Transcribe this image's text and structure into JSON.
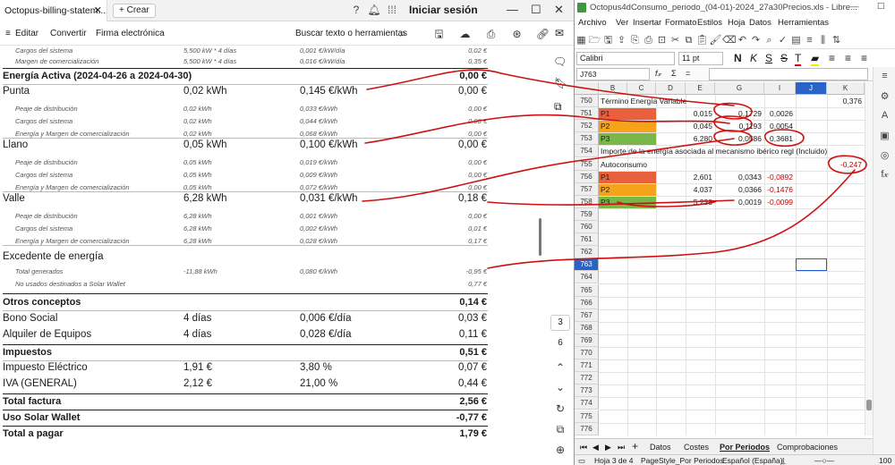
{
  "pdf": {
    "tab_title": "Octopus-billing-statem...",
    "new_tab": "Crear",
    "signin": "Iniciar sesión",
    "menu": {
      "edit": "Editar",
      "convert": "Convertir",
      "sign": "Firma electrónica",
      "search": "Buscar texto o herramientas"
    },
    "top_rows": [
      {
        "label": "Cargos del sistema",
        "c1": "5,500 kW * 4 días",
        "c2": "0,001 €/kW/día",
        "c3": "0,02 €"
      },
      {
        "label": "Margen de comercialización",
        "c1": "5,500 kW * 4 días",
        "c2": "0,016 €/kW/día",
        "c3": "0,35 €"
      }
    ],
    "energy_header": {
      "title": "Energía Activa (2024-04-26 a 2024-04-30)",
      "total": "0,00 €"
    },
    "periods": [
      {
        "name": "Punta",
        "qty": "0,02 kWh",
        "price": "0,145 €/kWh",
        "amount": "0,00 €",
        "subs": [
          {
            "label": "Peaje de distribución",
            "qty": "0,02 kWh",
            "price": "0,033 €/kWh",
            "amount": "0,00 €"
          },
          {
            "label": "Cargos del sistema",
            "qty": "0,02 kWh",
            "price": "0,044 €/kWh",
            "amount": "0,00 €"
          },
          {
            "label": "Energía y Margen de comercialización",
            "qty": "0,02 kWh",
            "price": "0,068 €/kWh",
            "amount": "0,00 €"
          }
        ]
      },
      {
        "name": "Llano",
        "qty": "0,05 kWh",
        "price": "0,100 €/kWh",
        "amount": "0,00 €",
        "subs": [
          {
            "label": "Peaje de distribución",
            "qty": "0,05 kWh",
            "price": "0,019 €/kWh",
            "amount": "0,00 €"
          },
          {
            "label": "Cargos del sistema",
            "qty": "0,05 kWh",
            "price": "0,009 €/kWh",
            "amount": "0,00 €"
          },
          {
            "label": "Energía y Margen de comercialización",
            "qty": "0,05 kWh",
            "price": "0,072 €/kWh",
            "amount": "0,00 €"
          }
        ]
      },
      {
        "name": "Valle",
        "qty": "6,28 kWh",
        "price": "0,031 €/kWh",
        "amount": "0,18 €",
        "subs": [
          {
            "label": "Peaje de distribución",
            "qty": "6,28 kWh",
            "price": "0,001 €/kWh",
            "amount": "0,00 €"
          },
          {
            "label": "Cargos del sistema",
            "qty": "6,28 kWh",
            "price": "0,002 €/kWh",
            "amount": "0,01 €"
          },
          {
            "label": "Energía y Margen de comercialización",
            "qty": "6,28 kWh",
            "price": "0,028 €/kWh",
            "amount": "0,17 €"
          }
        ]
      }
    ],
    "excedente": {
      "title": "Excedente de energía",
      "subs": [
        {
          "label": "Total generados",
          "qty": "-11,88 kWh",
          "price": "0,080 €/kWh",
          "amount": "-0,95 €"
        },
        {
          "label": "No usados destinados a Solar Wallet",
          "qty": "",
          "price": "",
          "amount": "0,77 €"
        }
      ]
    },
    "otros": {
      "title": "Otros conceptos",
      "total": "0,14 €",
      "rows": [
        {
          "label": "Bono Social",
          "qty": "4 días",
          "price": "0,006 €/día",
          "amount": "0,03 €"
        },
        {
          "label": "Alquiler de Equipos",
          "qty": "4 días",
          "price": "0,028 €/día",
          "amount": "0,11 €"
        }
      ]
    },
    "impuestos": {
      "title": "Impuestos",
      "total": "0,51 €",
      "rows": [
        {
          "label": "Impuesto Eléctrico",
          "qty": "1,91 €",
          "price": "3,80 %",
          "amount": "0,07 €"
        },
        {
          "label": "IVA (GENERAL)",
          "qty": "2,12 €",
          "price": "21,00 %",
          "amount": "0,44 €"
        }
      ]
    },
    "totals": [
      {
        "label": "Total factura",
        "amount": "2,56 €"
      },
      {
        "label": "Uso Solar Wallet",
        "amount": "-0,77 €"
      },
      {
        "label": "Total a pagar",
        "amount": "1,79 €"
      }
    ],
    "page_current": "3",
    "page_total": "6"
  },
  "sheet": {
    "title": "Octopus4dConsumo_periodo_(04-01)-2024_27a30Precios.xls - Libre...",
    "menu": [
      "Archivo",
      "Ver",
      "Insertar",
      "Formato",
      "Estilos",
      "Hoja",
      "Datos",
      "Herramientas"
    ],
    "font": "Calibri",
    "size": "11 pt",
    "cellref": "J763",
    "columns": [
      "B",
      "C",
      "D",
      "E",
      "G",
      "I",
      "J",
      "K"
    ],
    "rows": [
      "750",
      "751",
      "752",
      "753",
      "754",
      "755",
      "756",
      "757",
      "758",
      "759",
      "760",
      "761",
      "762",
      "763",
      "764",
      "765",
      "766",
      "767",
      "768",
      "769",
      "770",
      "771",
      "772",
      "773",
      "774",
      "775",
      "776"
    ],
    "active_row": "763",
    "cells": {
      "r750_B": "Término Energía Variable",
      "r750_K": "0,376",
      "r751_B": "P1",
      "r751_E": "0,015",
      "r751_G": "0,1729",
      "r751_I": "0,0026",
      "r752_B": "P2",
      "r752_E": "0,045",
      "r752_G": "0,1193",
      "r752_I": "0,0054",
      "r753_B": "P3",
      "r753_E": "6,280",
      "r753_G": "0,0586",
      "r753_I": "0,3681",
      "r754_B": "Importe de la energía asociada al mecanismo ibérico regl (Incluido)",
      "r755_B": "Autoconsumo",
      "r755_K": "-0,247",
      "r756_B": "P1",
      "r756_E": "2,601",
      "r756_G": "0,0343",
      "r756_I": "-0,0892",
      "r757_B": "P2",
      "r757_E": "4,037",
      "r757_G": "0,0366",
      "r757_I": "-0,1476",
      "r758_B": "P3",
      "r758_E": "5,238",
      "r758_G": "0,0019",
      "r758_I": "-0,0099"
    },
    "tabs": [
      "Datos",
      "Costes",
      "Por Periodos",
      "Comprobaciones"
    ],
    "active_tab": "Por Periodos",
    "status": {
      "sheet": "Hoja 3 de 4",
      "style": "PageStyle_Por Periodos",
      "lang": "Español (España)",
      "zoom": "100"
    },
    "colors": {
      "p1": "#e8603c",
      "p2": "#f5a31a",
      "p3": "#7ab648",
      "annotation": "#cc1111",
      "select": "#1e5bcd"
    }
  }
}
